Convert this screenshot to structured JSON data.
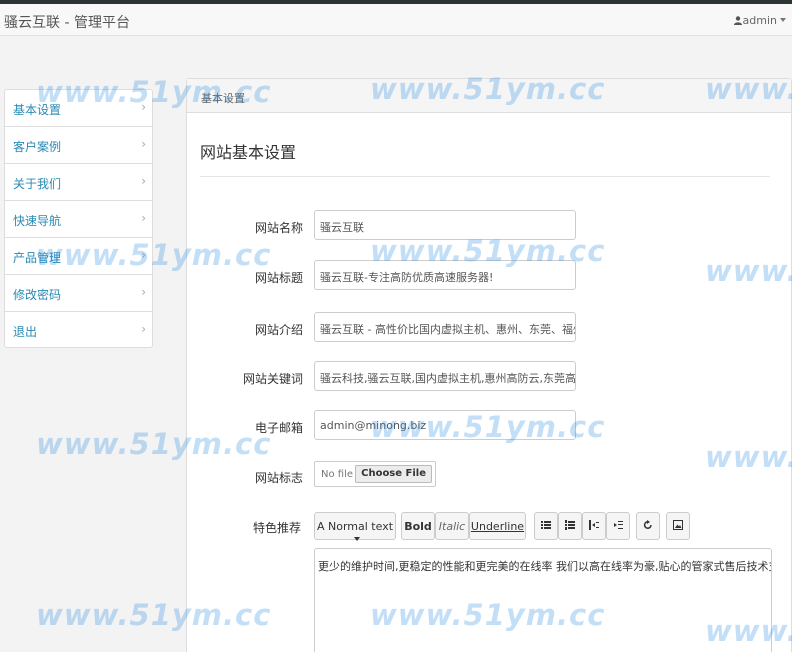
{
  "header": {
    "brand": "骚云互联 - 管理平台",
    "user": "admin"
  },
  "sidebar": {
    "items": [
      {
        "label": "基本设置"
      },
      {
        "label": "客户案例"
      },
      {
        "label": "关于我们"
      },
      {
        "label": "快速导航"
      },
      {
        "label": "产品管理"
      },
      {
        "label": "修改密码"
      },
      {
        "label": "退出"
      }
    ]
  },
  "panel": {
    "heading": "基本设置",
    "legend": "网站基本设置"
  },
  "form": {
    "site_name": {
      "label": "网站名称",
      "value": "骚云互联"
    },
    "site_title": {
      "label": "网站标题",
      "value": "骚云互联-专注高防优质高速服务器!"
    },
    "site_intro": {
      "label": "网站介绍",
      "value": "骚云互联 - 高性价比国内虚拟主机、惠州、东莞、福州、双线云"
    },
    "site_keywords": {
      "label": "网站关键词",
      "value": "骚云科技,骚云互联,国内虚拟主机,惠州高防云,东莞高防云,福州高"
    },
    "email": {
      "label": "电子邮箱",
      "value": "admin@minong.biz"
    },
    "logo": {
      "label": "网站标志",
      "file_placeholder": "No file selec...",
      "button": "Choose File"
    },
    "features": {
      "label": "特色推荐",
      "toolbar": {
        "format": "A Normal text",
        "bold": "Bold",
        "italic": "Italic",
        "underline": "Underline"
      },
      "content": "更少的维护时间,更稳定的性能和更完美的在线率 我们以高在线率为豪,贴心的管家式售后技术支持服务,让你建"
    }
  },
  "watermark": "www.51ym.cc",
  "colors": {
    "link": "#2a8ab3",
    "watermark": "#288ce1",
    "topbar_border": "#2d3436"
  }
}
